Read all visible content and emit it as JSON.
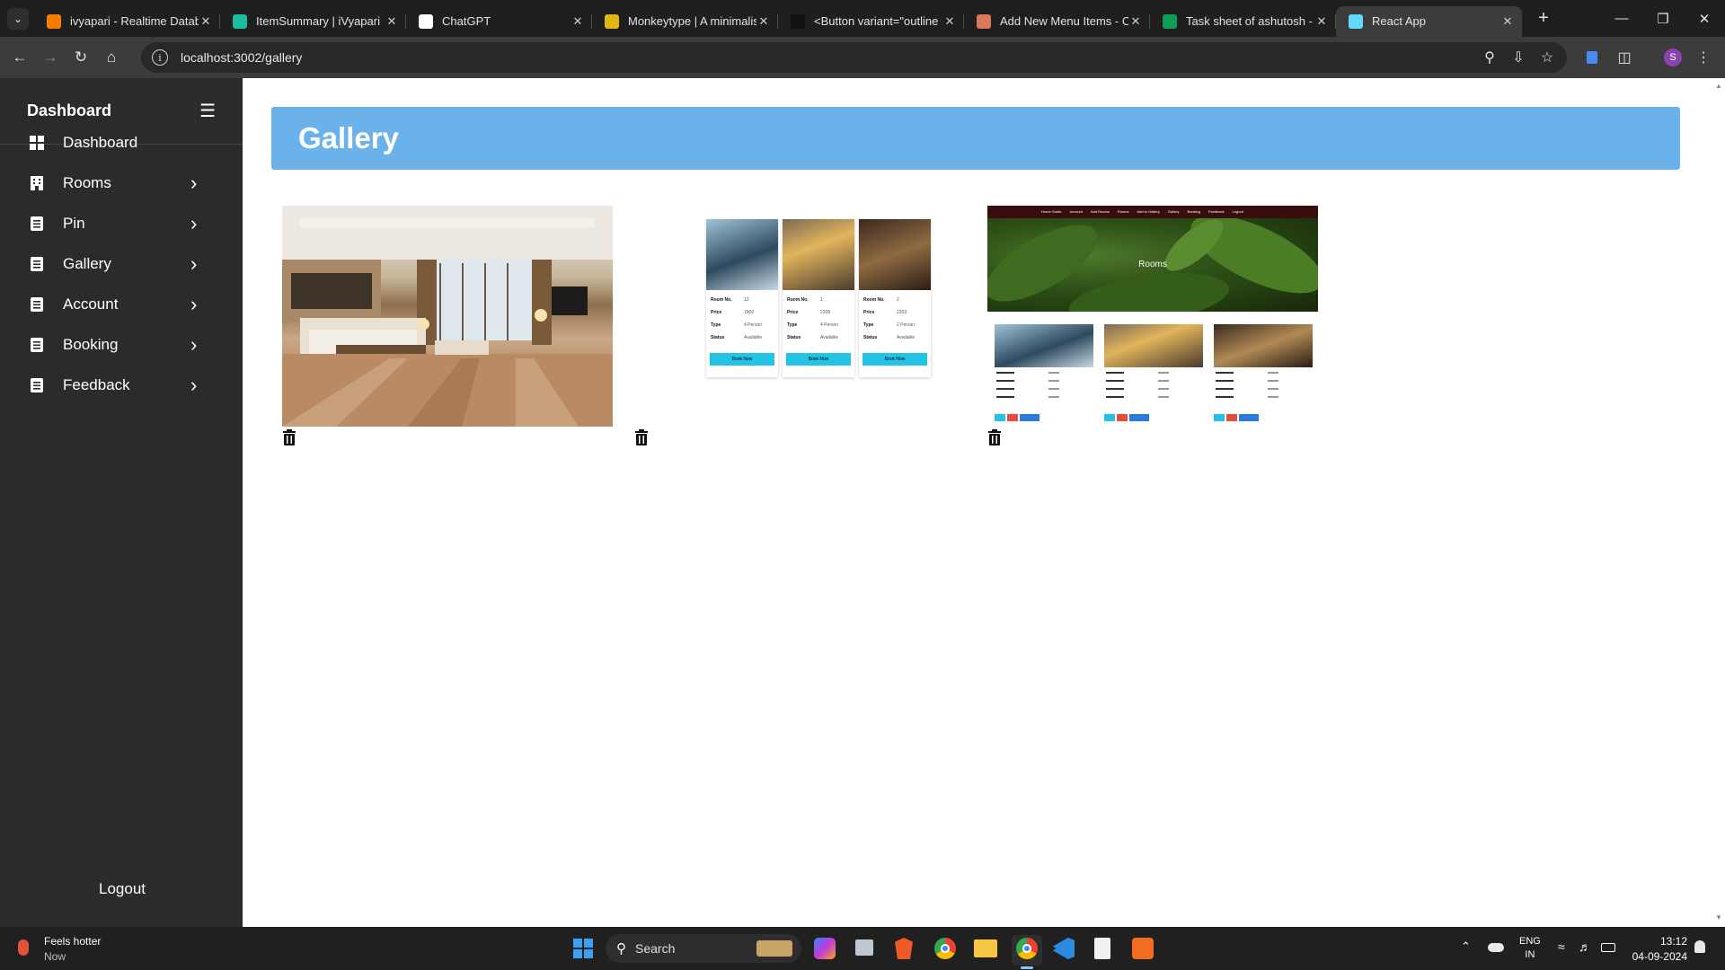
{
  "browser": {
    "tabs": [
      {
        "title": "ivyapari - Realtime Datab",
        "icon": "firebase-icon",
        "color": "#f57c00"
      },
      {
        "title": "ItemSummary | iVyapari",
        "icon": "ivyapari-icon",
        "color": "#1abc9c"
      },
      {
        "title": "ChatGPT",
        "icon": "chatgpt-icon",
        "color": "#ffffff"
      },
      {
        "title": "Monkeytype | A minimalis",
        "icon": "monkeytype-icon",
        "color": "#e2b714"
      },
      {
        "title": "<Button variant=\"outline",
        "icon": "github-icon",
        "color": "#111111"
      },
      {
        "title": "Add New Menu Items - C",
        "icon": "claude-icon",
        "color": "#d97757"
      },
      {
        "title": "Task sheet of ashutosh - G",
        "icon": "sheets-icon",
        "color": "#0f9d58"
      },
      {
        "title": "React App",
        "icon": "react-icon",
        "color": "#61dafb"
      }
    ],
    "url": "localhost:3002/gallery",
    "profile_initial": "S"
  },
  "sidebar": {
    "title": "Dashboard",
    "items": [
      {
        "label": "Dashboard",
        "icon": "grid-icon",
        "has_chevron": false
      },
      {
        "label": "Rooms",
        "icon": "building-icon",
        "has_chevron": true
      },
      {
        "label": "Pin",
        "icon": "list-icon",
        "has_chevron": true
      },
      {
        "label": "Gallery",
        "icon": "list-icon",
        "has_chevron": true
      },
      {
        "label": "Account",
        "icon": "list-icon",
        "has_chevron": true
      },
      {
        "label": "Booking",
        "icon": "list-icon",
        "has_chevron": true
      },
      {
        "label": "Feedback",
        "icon": "list-icon",
        "has_chevron": true
      }
    ],
    "logout": "Logout"
  },
  "main": {
    "title": "Gallery",
    "items": [
      {
        "kind": "bedroom-photo"
      },
      {
        "kind": "rooms-screenshot",
        "cards": [
          {
            "room_no_label": "Room No.",
            "room_no": "12",
            "price_label": "Price",
            "price": "1800",
            "type_label": "Type",
            "type": "4 Person",
            "status_label": "Status",
            "status": "Available",
            "button": "Book Now"
          },
          {
            "room_no_label": "Room No.",
            "room_no": "1",
            "price_label": "Price",
            "price": "2208",
            "type_label": "Type",
            "type": "4 Person",
            "status_label": "Status",
            "status": "Available",
            "button": "Book Now"
          },
          {
            "room_no_label": "Room No.",
            "room_no": "2",
            "price_label": "Price",
            "price": "2203",
            "type_label": "Type",
            "type": "2 Person",
            "status_label": "Status",
            "status": "Available",
            "button": "Book Now"
          }
        ]
      },
      {
        "kind": "rooms-page-screenshot",
        "nav": [
          "Home Guide",
          "Account",
          "Add Rooms",
          "Rooms",
          "Add to Gallery",
          "Gallery",
          "Booking",
          "Feedback",
          "Logout"
        ],
        "hero": "Rooms"
      }
    ]
  },
  "taskbar": {
    "weather_title": "Feels hotter",
    "weather_sub": "Now",
    "search": "Search",
    "lang": "ENG",
    "region": "IN",
    "time": "13:12",
    "date": "04-09-2024"
  },
  "colors": {
    "accent": "#6cb2ea",
    "sidebar": "#2b2b2b",
    "book_button": "#22c3e6"
  }
}
